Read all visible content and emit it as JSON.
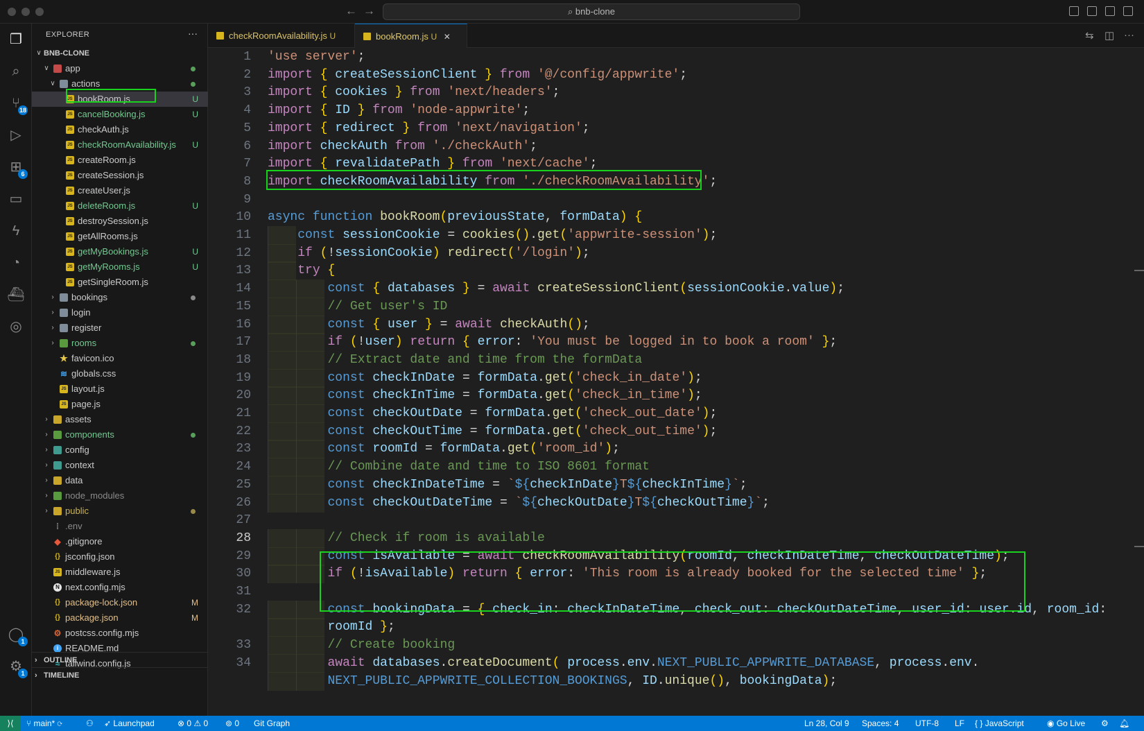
{
  "window": {
    "search": "bnb-clone"
  },
  "explorer": {
    "title": "EXPLORER",
    "root": "BNB-CLONE",
    "items": [
      {
        "name": "app",
        "git": "",
        "dot": "#58a05a"
      },
      {
        "name": "actions",
        "git": "",
        "dot": "#58a05a"
      },
      {
        "name": "bookRoom.js",
        "git": "U"
      },
      {
        "name": "cancelBooking.js",
        "git": "U"
      },
      {
        "name": "checkAuth.js",
        "git": ""
      },
      {
        "name": "checkRoomAvailability.js",
        "git": "U"
      },
      {
        "name": "createRoom.js",
        "git": ""
      },
      {
        "name": "createSession.js",
        "git": ""
      },
      {
        "name": "createUser.js",
        "git": ""
      },
      {
        "name": "deleteRoom.js",
        "git": "U"
      },
      {
        "name": "destroySession.js",
        "git": ""
      },
      {
        "name": "getAllRooms.js",
        "git": ""
      },
      {
        "name": "getMyBookings.js",
        "git": "U"
      },
      {
        "name": "getMyRooms.js",
        "git": "U"
      },
      {
        "name": "getSingleRoom.js",
        "git": ""
      },
      {
        "name": "bookings",
        "git": "",
        "dot": "#8a8a8a"
      },
      {
        "name": "login",
        "git": ""
      },
      {
        "name": "register",
        "git": ""
      },
      {
        "name": "rooms",
        "git": "",
        "dot": "#58a05a"
      },
      {
        "name": "favicon.ico",
        "git": ""
      },
      {
        "name": "globals.css",
        "git": ""
      },
      {
        "name": "layout.js",
        "git": ""
      },
      {
        "name": "page.js",
        "git": ""
      },
      {
        "name": "assets",
        "git": ""
      },
      {
        "name": "components",
        "git": "",
        "dot": "#58a05a"
      },
      {
        "name": "config",
        "git": ""
      },
      {
        "name": "context",
        "git": ""
      },
      {
        "name": "data",
        "git": ""
      },
      {
        "name": "node_modules",
        "git": ""
      },
      {
        "name": "public",
        "git": "",
        "dot": "#9a8a4a"
      },
      {
        "name": ".env",
        "git": ""
      },
      {
        "name": ".gitignore",
        "git": ""
      },
      {
        "name": "jsconfig.json",
        "git": ""
      },
      {
        "name": "middleware.js",
        "git": ""
      },
      {
        "name": "next.config.mjs",
        "git": ""
      },
      {
        "name": "package-lock.json",
        "git": "M"
      },
      {
        "name": "package.json",
        "git": "M"
      },
      {
        "name": "postcss.config.mjs",
        "git": ""
      },
      {
        "name": "README.md",
        "git": ""
      },
      {
        "name": "tailwind.config.js",
        "git": ""
      }
    ],
    "outline": "OUTLINE",
    "timeline": "TIMELINE"
  },
  "activity": {
    "scm_badge": "18",
    "ext_badge": "6",
    "account_badge": "1",
    "settings_badge": "1"
  },
  "tabs": [
    {
      "name": "checkRoomAvailability.js",
      "status": "U"
    },
    {
      "name": "bookRoom.js",
      "status": "U",
      "close": "✕"
    }
  ],
  "editor": {
    "lines": [
      {
        "n": "1",
        "code": "'use server';"
      },
      {
        "n": "2",
        "code": "import { createSessionClient } from '@/config/appwrite';"
      },
      {
        "n": "3",
        "code": "import { cookies } from 'next/headers';"
      },
      {
        "n": "4",
        "code": "import { ID } from 'node-appwrite';"
      },
      {
        "n": "5",
        "code": "import { redirect } from 'next/navigation';"
      },
      {
        "n": "6",
        "code": "import checkAuth from './checkAuth';"
      },
      {
        "n": "7",
        "code": "import { revalidatePath } from 'next/cache';"
      },
      {
        "n": "8",
        "code": "import checkRoomAvailability from './checkRoomAvailability';"
      },
      {
        "n": "9",
        "code": ""
      },
      {
        "n": "10",
        "code": "async function bookRoom(previousState, formData) {"
      },
      {
        "n": "11",
        "code": "    const sessionCookie = cookies().get('appwrite-session');"
      },
      {
        "n": "12",
        "code": "    if (!sessionCookie) redirect('/login');"
      },
      {
        "n": "13",
        "code": "    try {"
      },
      {
        "n": "14",
        "code": "        const { databases } = await createSessionClient(sessionCookie.value);"
      },
      {
        "n": "15",
        "code": "        // Get user's ID"
      },
      {
        "n": "16",
        "code": "        const { user } = await checkAuth();"
      },
      {
        "n": "17",
        "code": "        if (!user) return { error: 'You must be logged in to book a room' };"
      },
      {
        "n": "18",
        "code": "        // Extract date and time from the formData"
      },
      {
        "n": "19",
        "code": "        const checkInDate = formData.get('check_in_date');"
      },
      {
        "n": "20",
        "code": "        const checkInTime = formData.get('check_in_time');"
      },
      {
        "n": "21",
        "code": "        const checkOutDate = formData.get('check_out_date');"
      },
      {
        "n": "22",
        "code": "        const checkOutTime = formData.get('check_out_time');"
      },
      {
        "n": "23",
        "code": "        const roomId = formData.get('room_id');"
      },
      {
        "n": "24",
        "code": "        // Combine date and time to ISO 8601 format"
      },
      {
        "n": "25",
        "code": "        const checkInDateTime = `${checkInDate}T${checkInTime}`;"
      },
      {
        "n": "26",
        "code": "        const checkOutDateTime = `${checkOutDate}T${checkOutTime}`;"
      },
      {
        "n": "27",
        "code": ""
      },
      {
        "n": "28",
        "code": "        // Check if room is available"
      },
      {
        "n": "29",
        "code": "        const isAvailable = await checkRoomAvailability(roomId, checkInDateTime, checkOutDateTime);"
      },
      {
        "n": "30",
        "code": "        if (!isAvailable) return { error: 'This room is already booked for the selected time' };"
      },
      {
        "n": "31",
        "code": ""
      },
      {
        "n": "32",
        "code": "        const bookingData = { check_in: checkInDateTime, check_out: checkOutDateTime, user_id: user.id, room_id:"
      },
      {
        "n": "",
        "code": "        roomId };"
      },
      {
        "n": "33",
        "code": "        // Create booking"
      },
      {
        "n": "34",
        "code": "        await databases.createDocument( process.env.NEXT_PUBLIC_APPWRITE_DATABASE, process.env."
      },
      {
        "n": "",
        "code": "        NEXT_PUBLIC_APPWRITE_COLLECTION_BOOKINGS, ID.unique(), bookingData);"
      }
    ]
  },
  "status": {
    "branch": "main*",
    "launchpad": "Launchpad",
    "problems": "⊗ 0 ⚠ 0",
    "ports": "0",
    "git_graph": "Git Graph",
    "position": "Ln 28, Col 9",
    "spaces": "Spaces: 4",
    "encoding": "UTF-8",
    "eol": "LF",
    "language": "JavaScript",
    "go_live": "Go Live"
  }
}
